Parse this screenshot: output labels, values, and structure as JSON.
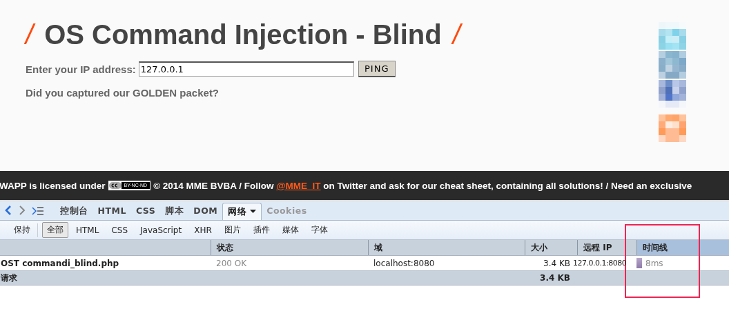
{
  "page": {
    "title_mark": "/",
    "title": "OS Command Injection - Blind",
    "ip_label": "Enter your IP address:",
    "ip_value": "127.0.0.1",
    "ping_button": "PING",
    "message": "Did you captured our GOLDEN packet?"
  },
  "footer": {
    "lead": "WAPP is licensed under",
    "license_badge": "BY-NC-ND",
    "text": "© 2014 MME BVBA / Follow",
    "link": "@MME_IT",
    "rest": "on Twitter and ask for our cheat sheet, containing all solutions! / Need an exclusive"
  },
  "devtools": {
    "tabs": [
      {
        "label": "控制台",
        "selected": false,
        "disabled": false
      },
      {
        "label": "HTML",
        "selected": false,
        "disabled": false
      },
      {
        "label": "CSS",
        "selected": false,
        "disabled": false
      },
      {
        "label": "脚本",
        "selected": false,
        "disabled": false
      },
      {
        "label": "DOM",
        "selected": false,
        "disabled": false
      },
      {
        "label": "网络",
        "selected": true,
        "disabled": false
      },
      {
        "label": "Cookies",
        "selected": false,
        "disabled": true
      }
    ],
    "persist_button": "保持",
    "filters": [
      {
        "label": "全部",
        "selected": true
      },
      {
        "label": "HTML",
        "selected": false
      },
      {
        "label": "CSS",
        "selected": false
      },
      {
        "label": "JavaScript",
        "selected": false
      },
      {
        "label": "XHR",
        "selected": false
      },
      {
        "label": "图片",
        "selected": false
      },
      {
        "label": "插件",
        "selected": false
      },
      {
        "label": "媒体",
        "selected": false
      },
      {
        "label": "字体",
        "selected": false
      }
    ],
    "columns": [
      {
        "selected": false
      },
      {
        "label": "状态",
        "selected": false
      },
      {
        "label": "域",
        "selected": false
      },
      {
        "label": "大小",
        "selected": false
      },
      {
        "label": "远程 IP",
        "selected": false
      },
      {
        "label": "时间线",
        "selected": true
      }
    ],
    "rows": [
      {
        "request": "OST commandi_blind.php",
        "status": "200 OK",
        "domain": "localhost:8080",
        "size": "3.4 KB",
        "remote_ip": "127.0.0.1:8080",
        "time": "8ms"
      }
    ],
    "summary": {
      "count": "请求",
      "size": "3.4 KB"
    }
  }
}
